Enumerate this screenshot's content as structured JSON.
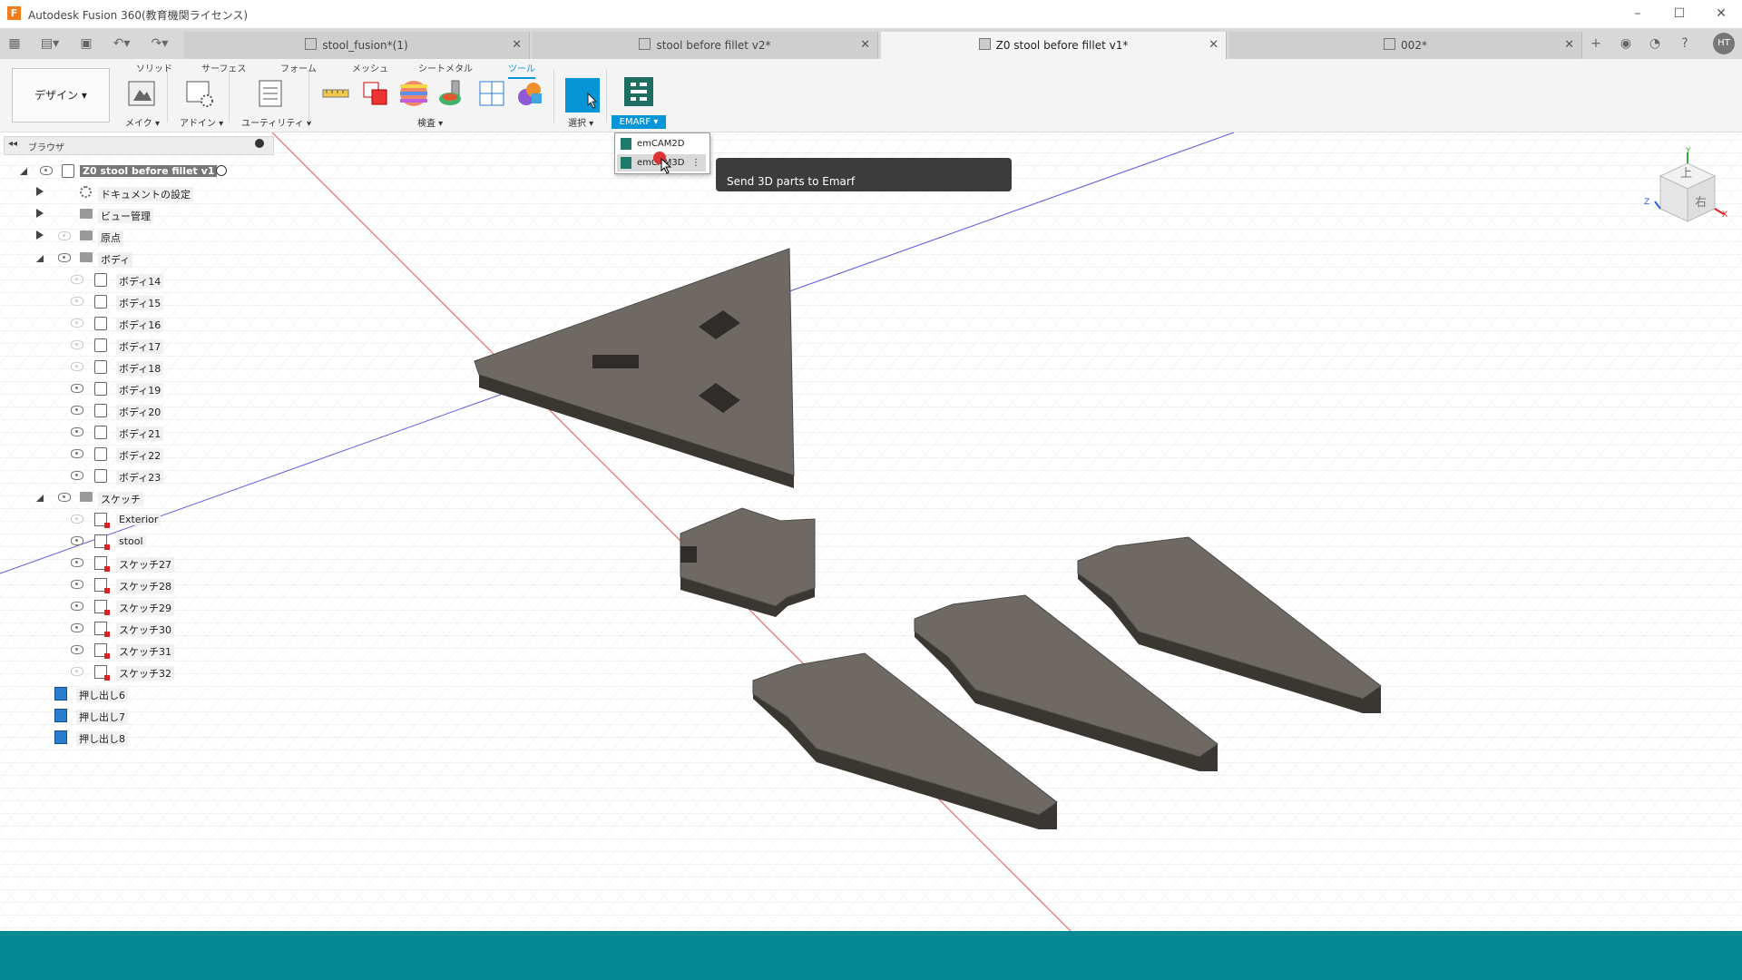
{
  "window": {
    "title": "Autodesk Fusion 360(教育機関ライセンス)"
  },
  "doc_tabs": [
    {
      "label": "stool_fusion*(1)",
      "active": false
    },
    {
      "label": "stool before fillet v2*",
      "active": false
    },
    {
      "label": "Z0 stool before fillet v1*",
      "active": true
    },
    {
      "label": "002*",
      "active": false
    }
  ],
  "user": {
    "initials": "HT"
  },
  "ribbon": {
    "workspace": "デザイン",
    "tabs": [
      "ソリッド",
      "サーフェス",
      "フォーム",
      "メッシュ",
      "シートメタル",
      "ツール"
    ],
    "active_tab": "ツール",
    "groups": {
      "make": "メイク",
      "addins": "アドイン",
      "utility": "ユーティリティ",
      "inspect": "検査",
      "select": "選択",
      "emarf": "EMARF"
    }
  },
  "browser": {
    "title": "ブラウザ",
    "root": "Z0 stool before fillet v1",
    "items": [
      {
        "label": "ドキュメントの設定",
        "type": "settings"
      },
      {
        "label": "ビュー管理",
        "type": "folder"
      },
      {
        "label": "原点",
        "type": "folder"
      },
      {
        "label": "ボディ",
        "type": "folder"
      },
      {
        "label": "ボディ14",
        "type": "body",
        "visible": false
      },
      {
        "label": "ボディ15",
        "type": "body",
        "visible": false
      },
      {
        "label": "ボディ16",
        "type": "body",
        "visible": false
      },
      {
        "label": "ボディ17",
        "type": "body",
        "visible": false
      },
      {
        "label": "ボディ18",
        "type": "body",
        "visible": false
      },
      {
        "label": "ボディ19",
        "type": "body",
        "visible": true
      },
      {
        "label": "ボディ20",
        "type": "body",
        "visible": true
      },
      {
        "label": "ボディ21",
        "type": "body",
        "visible": true
      },
      {
        "label": "ボディ22",
        "type": "body",
        "visible": true
      },
      {
        "label": "ボディ23",
        "type": "body",
        "visible": true
      },
      {
        "label": "スケッチ",
        "type": "folder"
      },
      {
        "label": "Exterior",
        "type": "sketch",
        "visible": false
      },
      {
        "label": "stool",
        "type": "sketch",
        "visible": true
      },
      {
        "label": "スケッチ27",
        "type": "sketch",
        "visible": true
      },
      {
        "label": "スケッチ28",
        "type": "sketch",
        "visible": true
      },
      {
        "label": "スケッチ29",
        "type": "sketch",
        "visible": true
      },
      {
        "label": "スケッチ30",
        "type": "sketch",
        "visible": true
      },
      {
        "label": "スケッチ31",
        "type": "sketch",
        "visible": true
      },
      {
        "label": "スケッチ32",
        "type": "sketch",
        "visible": false
      },
      {
        "label": "押し出し6",
        "type": "extrude"
      },
      {
        "label": "押し出し7",
        "type": "extrude"
      },
      {
        "label": "押し出し8",
        "type": "extrude"
      }
    ]
  },
  "emarf_menu": {
    "items": [
      "emCAM2D",
      "emCAM3D"
    ],
    "hovered": "emCAM3D"
  },
  "tooltip": "Send 3D parts to Emarf",
  "viewcube": {
    "top": "上",
    "right": "右",
    "axis_x": "X",
    "axis_y": "Y",
    "axis_z": "Z"
  },
  "colors": {
    "accent": "#0696d7",
    "bottom_band": "#048a94",
    "part_face": "#6e6a63"
  }
}
